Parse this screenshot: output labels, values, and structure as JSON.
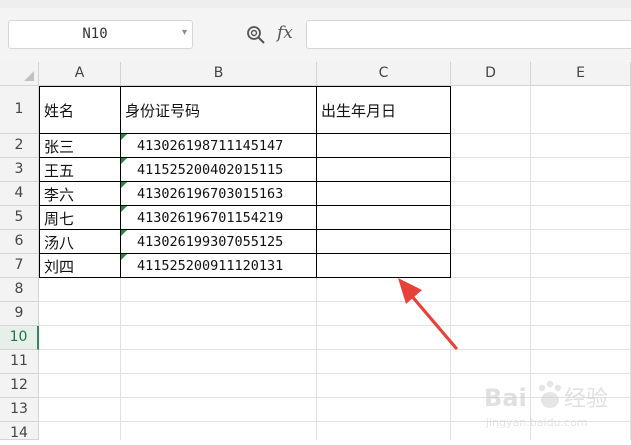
{
  "namebox": {
    "value": "N10"
  },
  "formula": {
    "fx_label": "fx",
    "value": ""
  },
  "columns": [
    "A",
    "B",
    "C",
    "D",
    "E"
  ],
  "rows": [
    "1",
    "2",
    "3",
    "4",
    "5",
    "6",
    "7",
    "8",
    "9",
    "10",
    "11",
    "12",
    "13",
    "14"
  ],
  "selected_row": "10",
  "table": {
    "headers": [
      "姓名",
      "身份证号码",
      "出生年月日"
    ],
    "records": [
      {
        "name": "张三",
        "id": "413026198711145147",
        "birth": ""
      },
      {
        "name": "王五",
        "id": "411525200402015115",
        "birth": ""
      },
      {
        "name": "李六",
        "id": "413026196703015163",
        "birth": ""
      },
      {
        "name": "周七",
        "id": "413026196701154219",
        "birth": ""
      },
      {
        "name": "汤八",
        "id": "413026199307055125",
        "birth": ""
      },
      {
        "name": "刘四",
        "id": "411525200911120131",
        "birth": ""
      }
    ]
  },
  "annotation": {
    "arrow_color": "#e8413a"
  },
  "watermark": {
    "text_main": "Bai",
    "text_cn": "经验",
    "text_sub": "jingyan.baidu.com"
  }
}
